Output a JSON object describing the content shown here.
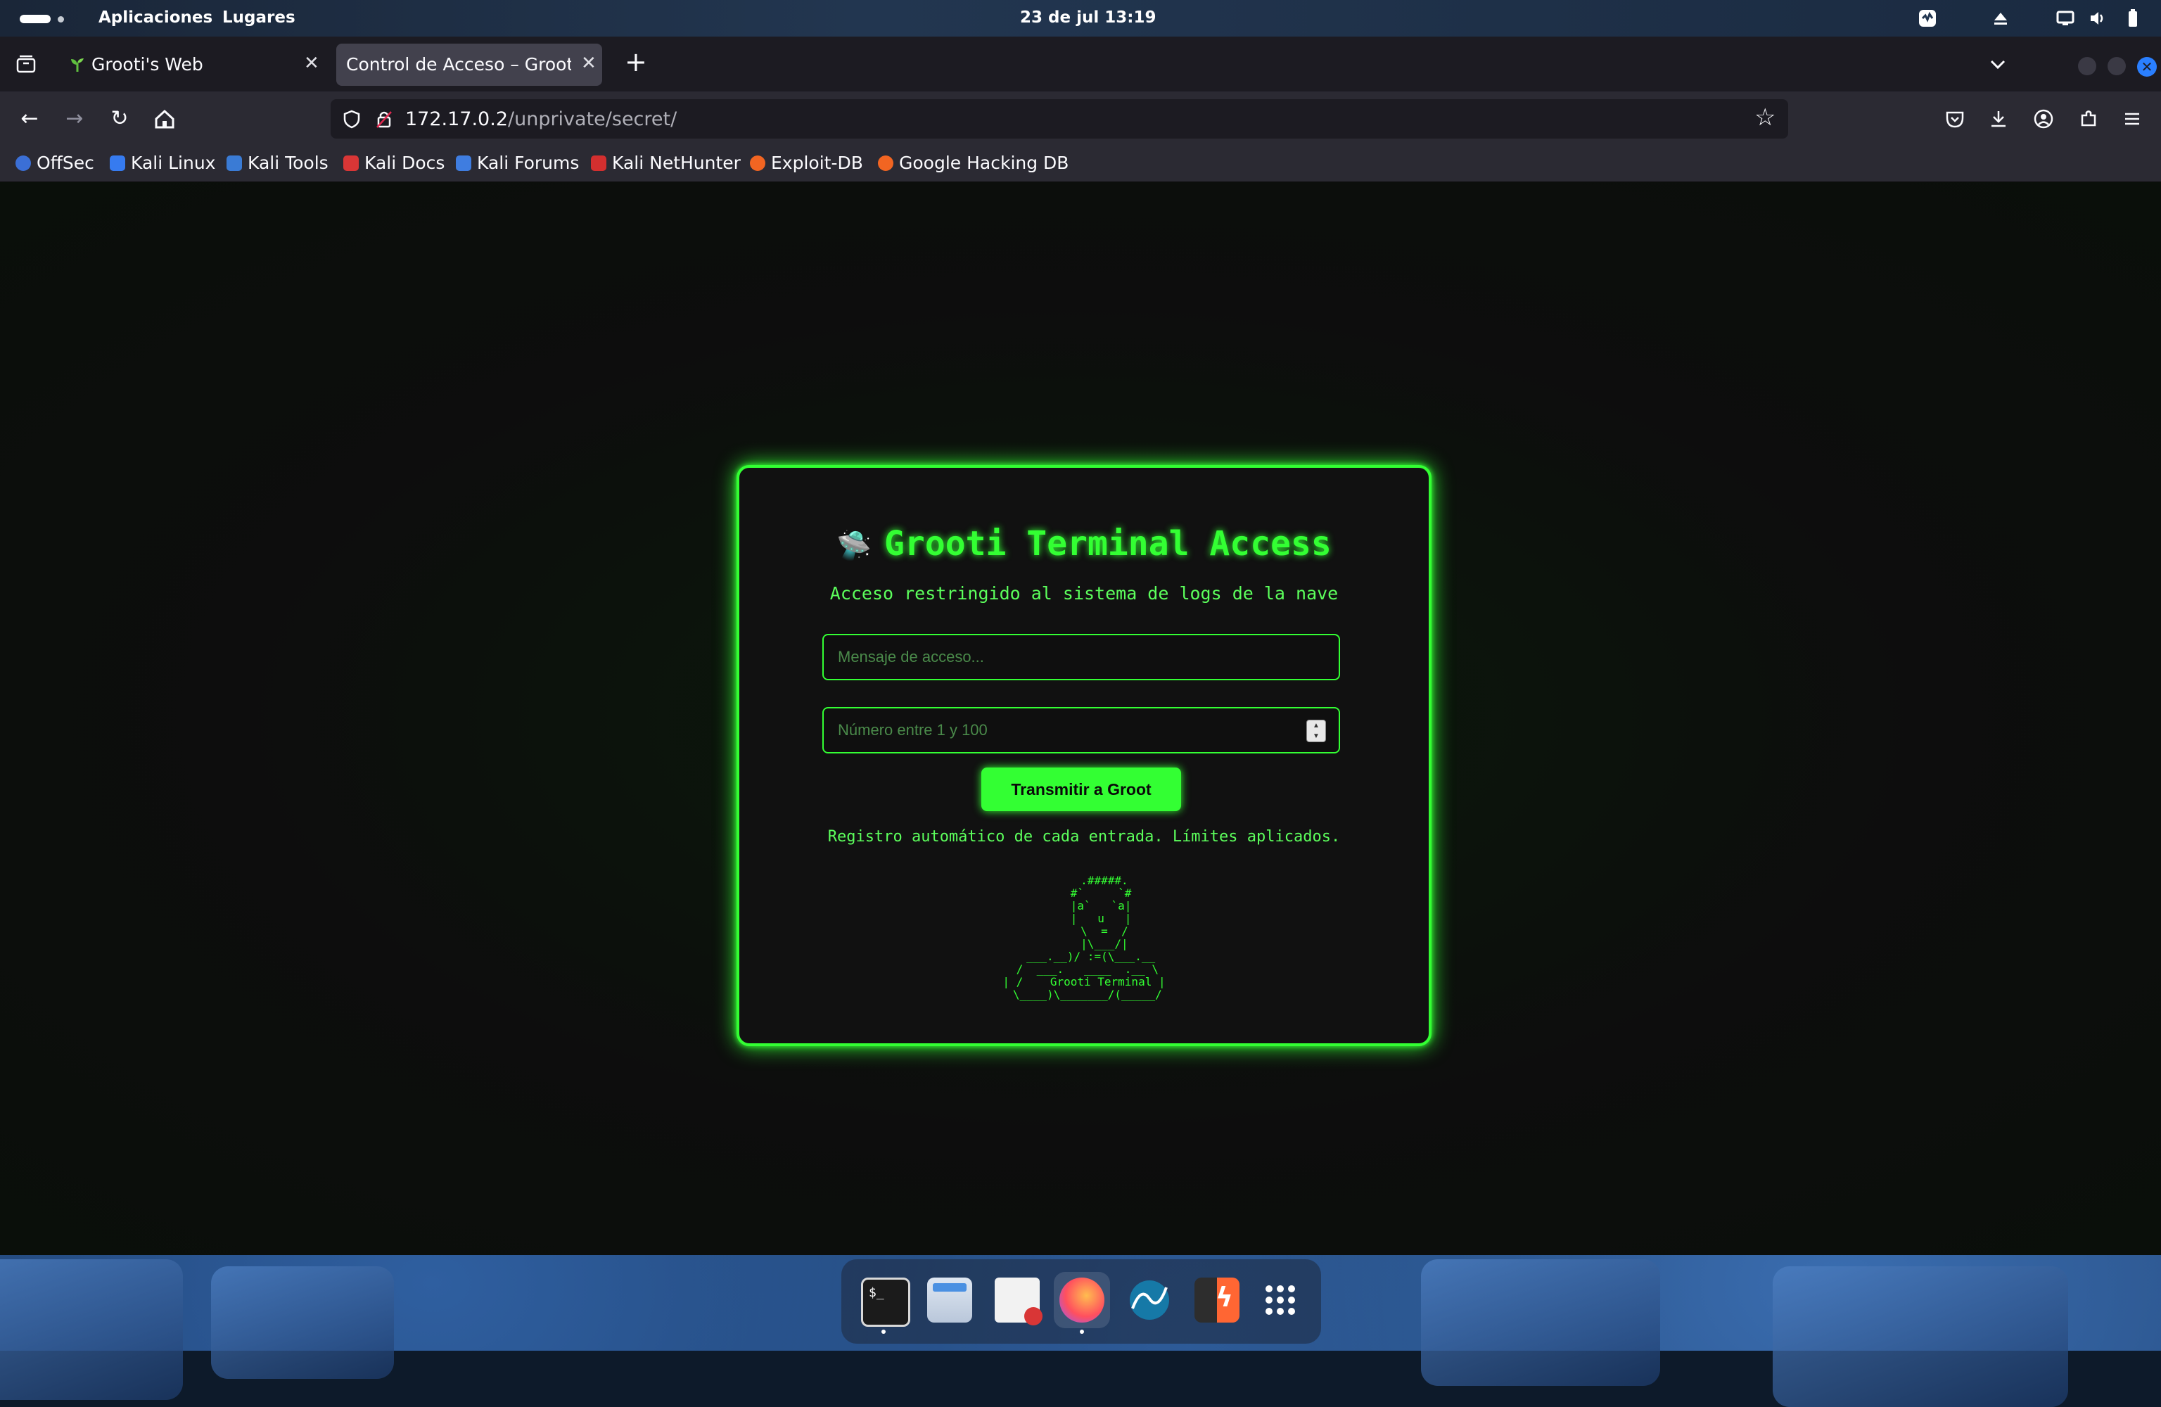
{
  "top_panel": {
    "menu_apps": "Aplicaciones",
    "menu_places": "Lugares",
    "clock": "23 de jul  13:19"
  },
  "browser": {
    "tabs": [
      {
        "label": "Grooti's Web",
        "icon": "sprout-icon",
        "active": false
      },
      {
        "label": "Control de Acceso – Grooti S",
        "icon": "",
        "active": true
      }
    ],
    "new_tab": "+",
    "url_host": "172.17.0.2",
    "url_path": "/unprivate/secret/",
    "bookmarks": [
      {
        "label": "OffSec",
        "color": "#3b6fd6"
      },
      {
        "label": "Kali Linux",
        "color": "#367bf0"
      },
      {
        "label": "Kali Tools",
        "color": "#3a7bd5"
      },
      {
        "label": "Kali Docs",
        "color": "#d93636"
      },
      {
        "label": "Kali Forums",
        "color": "#3f7de0"
      },
      {
        "label": "Kali NetHunter",
        "color": "#d32f2f"
      },
      {
        "label": "Exploit-DB",
        "color": "#f26522"
      },
      {
        "label": "Google Hacking DB",
        "color": "#f26522"
      }
    ]
  },
  "card": {
    "icon": "ufo-icon",
    "title": "Grooti Terminal Access",
    "subtitle": "Acceso restringido al sistema de logs de la nave",
    "message_placeholder": "Mensaje de acceso...",
    "number_placeholder": "Número entre 1 y 100",
    "submit_label": "Transmitir a Groot",
    "note": "Registro automático de cada entrada. Límites aplicados.",
    "ascii_art": "      .#####.\n     #`     `#\n     |a`   `a|\n     |   u   |\n      \\  =  /\n      |\\___/|\n  ___.__)/ :=(\\___.__\n /  ___.   ____  .__ \\\n| /    Grooti Terminal |\n \\____)\\_______/(_____/"
  },
  "colors": {
    "accent": "#33ff33",
    "card_bg": "#111111"
  },
  "dock": [
    "terminal-icon",
    "files-icon",
    "text-editor-icon",
    "firefox-icon",
    "wireshark-icon",
    "burpsuite-icon",
    "app-grid-icon"
  ]
}
